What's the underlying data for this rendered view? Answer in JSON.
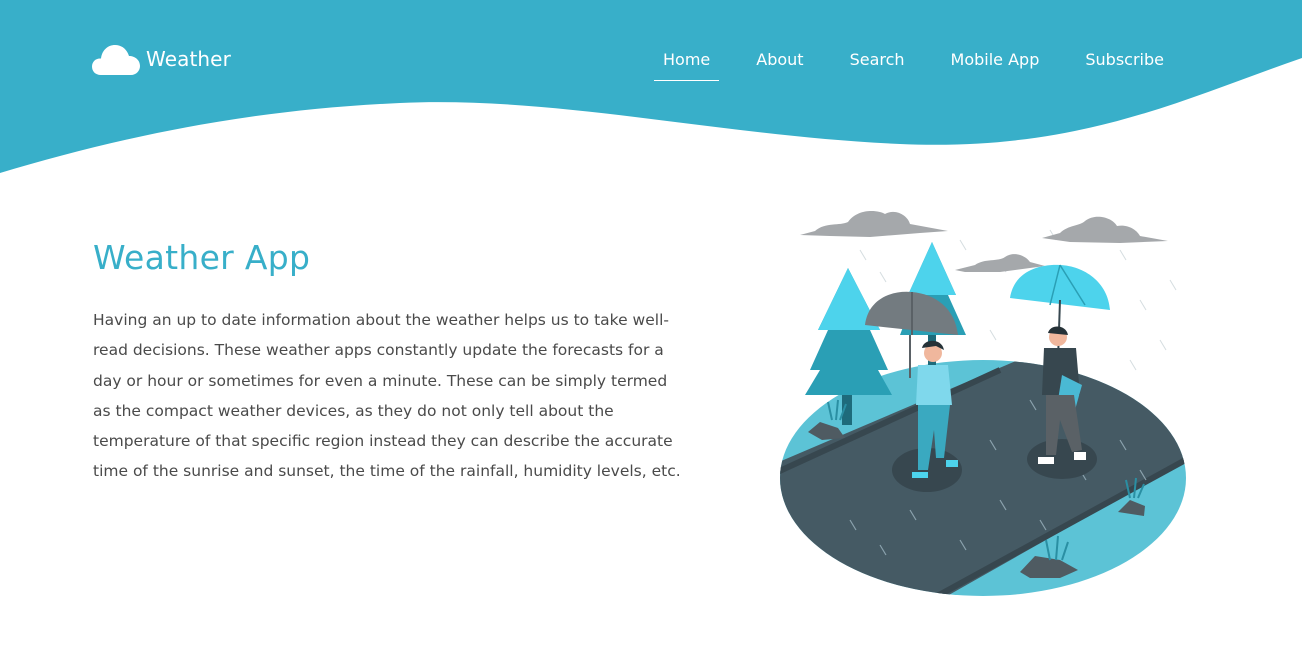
{
  "header": {
    "brand": "Weather",
    "nav": [
      {
        "label": "Home",
        "active": true
      },
      {
        "label": "About",
        "active": false
      },
      {
        "label": "Search",
        "active": false
      },
      {
        "label": "Mobile App",
        "active": false
      },
      {
        "label": "Subscribe",
        "active": false
      }
    ]
  },
  "hero": {
    "title": "Weather App",
    "text": "Having an up to date information about the weather helps us to take well-read decisions. These weather apps constantly update the forecasts for a day or hour or sometimes for even a minute. These can be simply termed as the compact weather devices, as they do not only tell about the temperature of that specific region instead they can describe the accurate time of the sunrise and sunset, the time of the rainfall, humidity levels, etc."
  },
  "colors": {
    "brand": "#38afc9",
    "text": "#4a4a4a",
    "road": "#455a64",
    "cloud": "#a5a8ab"
  },
  "icons": {
    "logo": "cloud-icon"
  }
}
